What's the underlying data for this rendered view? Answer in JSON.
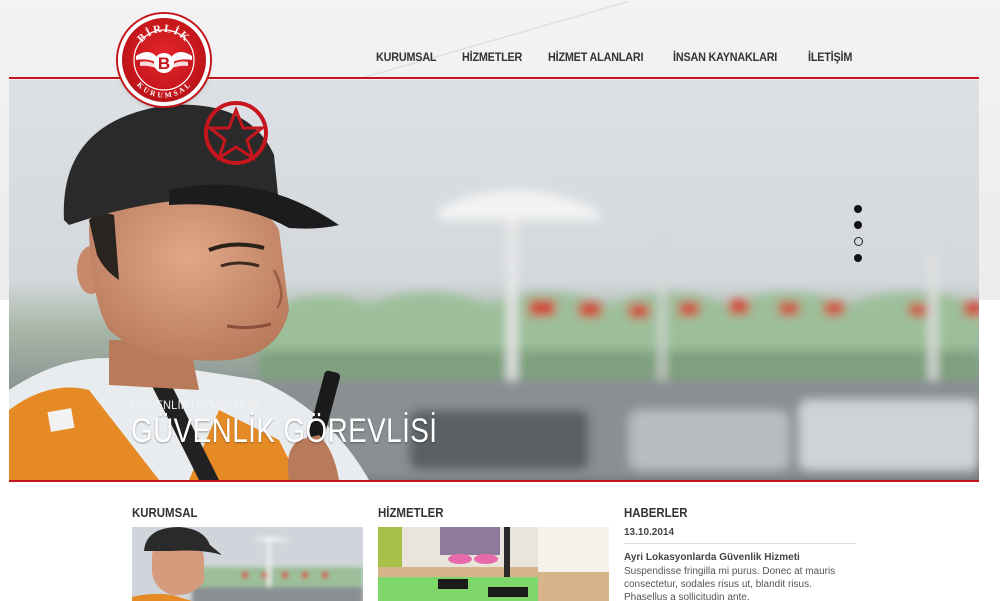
{
  "brand": {
    "logo_top_text": "BİRLİK",
    "logo_bottom_text": "KURUMSAL",
    "logo_letter": "B",
    "primary_color": "#c4161c"
  },
  "nav": {
    "items": [
      {
        "label": "KURUMSAL"
      },
      {
        "label": "HİZMETLER"
      },
      {
        "label": "HİZMET ALANLARI"
      },
      {
        "label": "İNSAN KAYNAKLARI"
      },
      {
        "label": "İLETİŞİM"
      }
    ]
  },
  "slider": {
    "subtitle": "GÜVENLİK HİZMETLERİ",
    "title": "GÜVENLİK GÖREVLİSİ",
    "slide_count": 4,
    "active_slide": 3
  },
  "sections": {
    "kurumsal": {
      "heading": "KURUMSAL"
    },
    "hizmetler": {
      "heading": "HİZMETLER"
    },
    "haberler": {
      "heading": "HABERLER",
      "date": "13.10.2014",
      "news_title": "Ayri Lokasyonlarda Güvenlik Hizmeti",
      "news_body": "Suspendisse fringilla mi purus. Donec at mauris consectetur, sodales risus ut, blandit risus. Phasellus a sollicitudin ante."
    }
  }
}
